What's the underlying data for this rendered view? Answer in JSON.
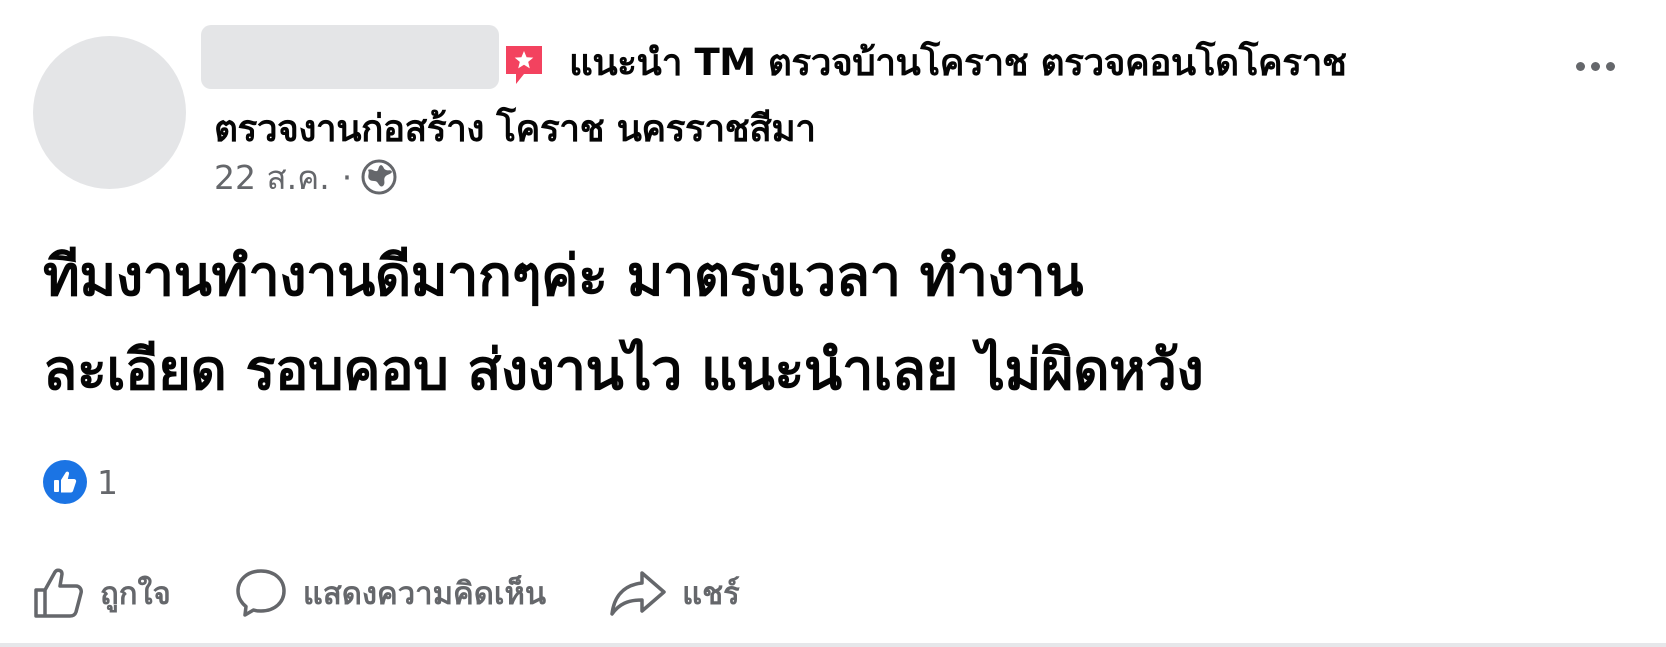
{
  "header": {
    "author_name": "",
    "recommendation_icon": "recommend-flag-icon",
    "line1": "แนะนำ TM ตรวจบ้านโคราช ตรวจคอนโดโคราช",
    "line2": "ตรวจงานก่อสร้าง โคราช นครราชสีมา",
    "more_icon": "more-options-icon"
  },
  "meta": {
    "date": "22 ส.ค.",
    "separator": "·",
    "audience_icon": "globe-icon"
  },
  "post": {
    "lines": [
      "ทีมงานทำงานดีมากๆค่ะ มาตรงเวลา ทำงาน",
      "ละเอียด รอบคอบ ส่งงานไว แนะนำเลย ไม่ผิดหวัง"
    ]
  },
  "reactions": {
    "icon": "like-reaction-icon",
    "count": "1"
  },
  "actions": {
    "like_label": "ถูกใจ",
    "comment_label": "แสดงความคิดเห็น",
    "share_label": "แชร์"
  },
  "colors": {
    "text": "#050505",
    "secondary": "#65676b",
    "like_blue": "#1b74e4",
    "recommend_red": "#f3425f",
    "placeholder_gray": "#e4e5e7"
  }
}
